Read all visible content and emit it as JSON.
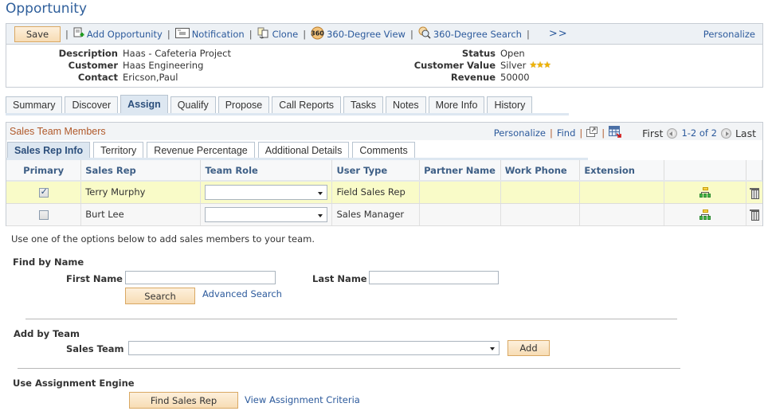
{
  "page": {
    "title": "Opportunity"
  },
  "toolbar": {
    "save_label": "Save",
    "items": [
      {
        "label": "Add Opportunity",
        "icon": "add-document-icon"
      },
      {
        "label": "Notification",
        "icon": "envelope-icon"
      },
      {
        "label": "Clone",
        "icon": "clone-icon"
      },
      {
        "label": "360-Degree View",
        "icon": "360-icon"
      },
      {
        "label": "360-Degree Search",
        "icon": "360-search-icon"
      }
    ],
    "more_label": ">>",
    "personalize_label": "Personalize"
  },
  "summary": {
    "left": [
      {
        "label": "Description",
        "value": "Haas - Cafeteria Project"
      },
      {
        "label": "Customer",
        "value": "Haas Engineering"
      },
      {
        "label": "Contact",
        "value": "Ericson,Paul"
      }
    ],
    "right": [
      {
        "label": "Status",
        "value": "Open"
      },
      {
        "label": "Customer Value",
        "value": "Silver",
        "stars": "★★★"
      },
      {
        "label": "Revenue",
        "value": "50000"
      }
    ]
  },
  "page_tabs": [
    {
      "label": "Summary",
      "active": false
    },
    {
      "label": "Discover",
      "active": false
    },
    {
      "label": "Assign",
      "active": true
    },
    {
      "label": "Qualify",
      "active": false
    },
    {
      "label": "Propose",
      "active": false
    },
    {
      "label": "Call Reports",
      "active": false
    },
    {
      "label": "Tasks",
      "active": false
    },
    {
      "label": "Notes",
      "active": false
    },
    {
      "label": "More Info",
      "active": false
    },
    {
      "label": "History",
      "active": false
    }
  ],
  "grid": {
    "title": "Sales Team Members",
    "nav": {
      "personalize": "Personalize",
      "find": "Find",
      "first": "First",
      "range": "1-2 of 2",
      "last": "Last"
    },
    "sub_tabs": [
      {
        "label": "Sales Rep Info",
        "active": true
      },
      {
        "label": "Territory",
        "active": false
      },
      {
        "label": "Revenue Percentage",
        "active": false
      },
      {
        "label": "Additional Details",
        "active": false
      },
      {
        "label": "Comments",
        "active": false
      }
    ],
    "columns": [
      "Primary",
      "Sales Rep",
      "Team Role",
      "User Type",
      "Partner Name",
      "Work Phone",
      "Extension",
      "",
      ""
    ],
    "rows": [
      {
        "primary": true,
        "sales_rep": "Terry Murphy",
        "team_role": "",
        "user_type": "Field Sales Rep",
        "partner_name": "",
        "work_phone": "",
        "extension": ""
      },
      {
        "primary": false,
        "sales_rep": "Burt Lee",
        "team_role": "",
        "user_type": "Sales Manager",
        "partner_name": "",
        "work_phone": "",
        "extension": ""
      }
    ]
  },
  "form": {
    "hint": "Use one of the options below to add sales members to your team.",
    "find_by_name": {
      "title": "Find by Name",
      "first_name_label": "First Name",
      "first_name_value": "",
      "last_name_label": "Last Name",
      "last_name_value": "",
      "search_label": "Search",
      "advanced_search_label": "Advanced Search"
    },
    "add_by_team": {
      "title": "Add by Team",
      "sales_team_label": "Sales Team",
      "sales_team_value": "",
      "add_label": "Add"
    },
    "assignment_engine": {
      "title": "Use Assignment Engine",
      "find_sales_rep_label": "Find Sales Rep",
      "view_criteria_label": "View Assignment Criteria"
    }
  }
}
